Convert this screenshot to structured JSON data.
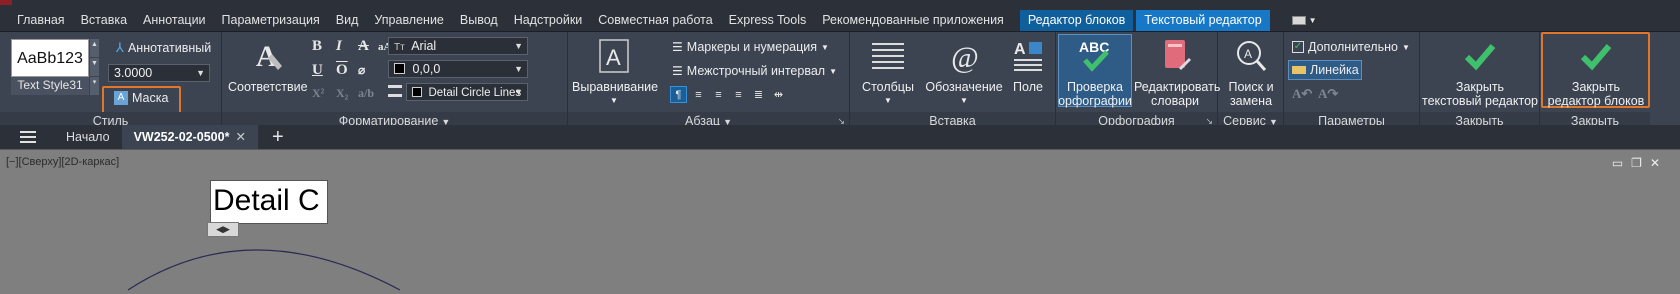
{
  "menu_tabs": [
    "Главная",
    "Вставка",
    "Аннотации",
    "Параметризация",
    "Вид",
    "Управление",
    "Вывод",
    "Надстройки",
    "Совместная работа",
    "Express Tools",
    "Рекомендованные приложения"
  ],
  "context_tabs": {
    "block_editor": "Редактор блоков",
    "text_editor": "Текстовый редактор"
  },
  "style_panel": {
    "sample_text": "AaBb123",
    "style_name": "Text Style31",
    "annotative": "Аннотативный",
    "height_value": "3.0000",
    "mask": "Маска",
    "title": "Стиль"
  },
  "format_panel": {
    "match": "Соответствие",
    "font": "Arial",
    "color": "0,0,0",
    "layer": "Detail Circle Lines",
    "title": "Форматирование"
  },
  "paragraph_panel": {
    "justify": "Выравнивание",
    "bullets": "Маркеры и нумерация",
    "line_spacing": "Межстрочный интервал",
    "title": "Абзац"
  },
  "insert_panel": {
    "columns": "Столбцы",
    "symbol": "Обозначение",
    "field": "Поле",
    "title": "Вставка"
  },
  "spelling_panel": {
    "check": "Проверка орфографии",
    "check_l1": "Проверка",
    "check_l2": "орфографии",
    "edit_l1": "Редактировать",
    "edit_l2": "словари",
    "icon_text": "ABC",
    "title": "Орфография"
  },
  "tools_panel": {
    "find_l1": "Поиск и",
    "find_l2": "замена",
    "title": "Сервис"
  },
  "options_panel": {
    "more": "Дополнительно",
    "ruler": "Линейка",
    "title": "Параметры"
  },
  "close_panel": {
    "close_text_l1": "Закрыть",
    "close_text_l2": "текстовый редактор",
    "title": "Закрыть"
  },
  "close_block_panel": {
    "close_block_l1": "Закрыть",
    "close_block_l2": "редактор блоков",
    "title": "Закрыть"
  },
  "doc_tabs": {
    "home": "Начало",
    "active": "VW252-02-0500*"
  },
  "viewport": {
    "label": "[−][Сверху][2D-каркас]",
    "text": "Detail C"
  },
  "colors": {
    "accent_blue": "#1778c7",
    "highlight": "#e0762b",
    "check_green": "#3fc06c"
  }
}
